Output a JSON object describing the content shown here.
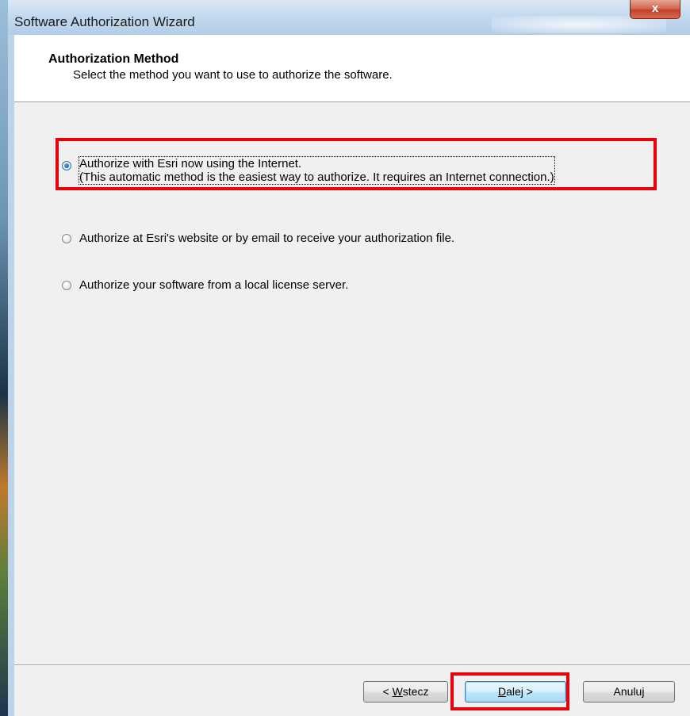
{
  "window": {
    "title": "Software Authorization Wizard",
    "close_glyph": "x"
  },
  "header": {
    "title": "Authorization Method",
    "subtitle": "Select the method you want to use to authorize the software."
  },
  "options": [
    {
      "line1": "Authorize with Esri now using the Internet.",
      "line2": "(This automatic method is the easiest way to authorize. It requires an Internet connection.)",
      "selected": true
    },
    {
      "line1": "Authorize at Esri's website or by email to receive your authorization file.",
      "selected": false
    },
    {
      "line1": "Authorize your software from a local license server.",
      "selected": false
    }
  ],
  "buttons": {
    "back_mnemonic": "W",
    "back_prefix": "< ",
    "back_rest": "stecz",
    "next_mnemonic": "D",
    "next_rest": "alej >",
    "cancel": "Anuluj"
  },
  "colors": {
    "highlight": "#e8000b",
    "window_frame": "#bcd3ea",
    "dialog_bg": "#f0f0f0"
  }
}
